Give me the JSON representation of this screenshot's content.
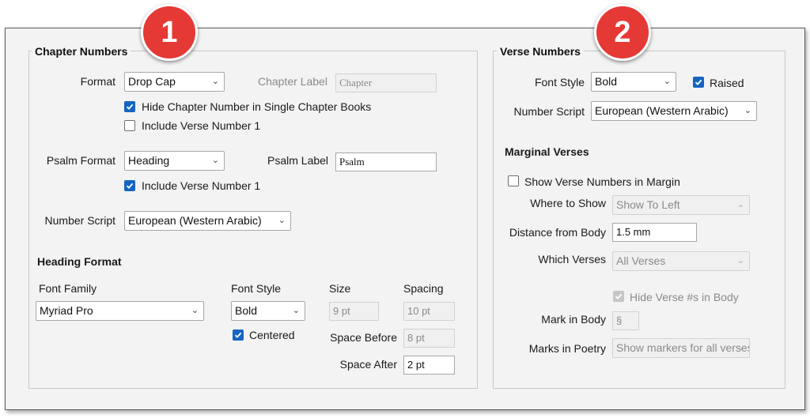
{
  "chapter": {
    "title": "Chapter Numbers",
    "format_label": "Format",
    "format_value": "Drop Cap",
    "chapter_label_label": "Chapter Label",
    "chapter_label_value": "Chapter",
    "hide_single_label": "Hide Chapter Number in Single Chapter Books",
    "hide_single_checked": true,
    "include_verse1_label": "Include Verse Number 1",
    "include_verse1_checked": false,
    "psalm_format_label": "Psalm Format",
    "psalm_format_value": "Heading",
    "psalm_label_label": "Psalm Label",
    "psalm_label_value": "Psalm",
    "psalm_include_verse1_label": "Include Verse Number 1",
    "psalm_include_verse1_checked": true,
    "number_script_label": "Number Script",
    "number_script_value": "European (Western Arabic)"
  },
  "heading": {
    "title": "Heading Format",
    "font_family_label": "Font Family",
    "font_family_value": "Myriad Pro",
    "font_style_label": "Font Style",
    "font_style_value": "Bold",
    "size_label": "Size",
    "size_value": "9 pt",
    "spacing_label": "Spacing",
    "spacing_value": "10 pt",
    "centered_label": "Centered",
    "centered_checked": true,
    "space_before_label": "Space Before",
    "space_before_value": "8 pt",
    "space_after_label": "Space After",
    "space_after_value": "2 pt"
  },
  "verse": {
    "title": "Verse Numbers",
    "font_style_label": "Font Style",
    "font_style_value": "Bold",
    "raised_label": "Raised",
    "raised_checked": true,
    "number_script_label": "Number Script",
    "number_script_value": "European (Western Arabic)"
  },
  "marginal": {
    "title": "Marginal Verses",
    "show_margin_label": "Show Verse Numbers in Margin",
    "show_margin_checked": false,
    "where_label": "Where to Show",
    "where_value": "Show To Left",
    "distance_label": "Distance from Body",
    "distance_value": "1.5 mm",
    "which_label": "Which Verses",
    "which_value": "All Verses",
    "hide_body_label": "Hide Verse #s in Body",
    "hide_body_checked": true,
    "mark_body_label": "Mark in Body",
    "mark_body_value": "§",
    "marks_poetry_label": "Marks in Poetry",
    "marks_poetry_value": "Show markers for all verses"
  },
  "badges": {
    "one": "1",
    "two": "2"
  },
  "colors": {
    "badge": "#e53935",
    "checkbox": "#1565c0",
    "panel": "#f3f3f3"
  }
}
